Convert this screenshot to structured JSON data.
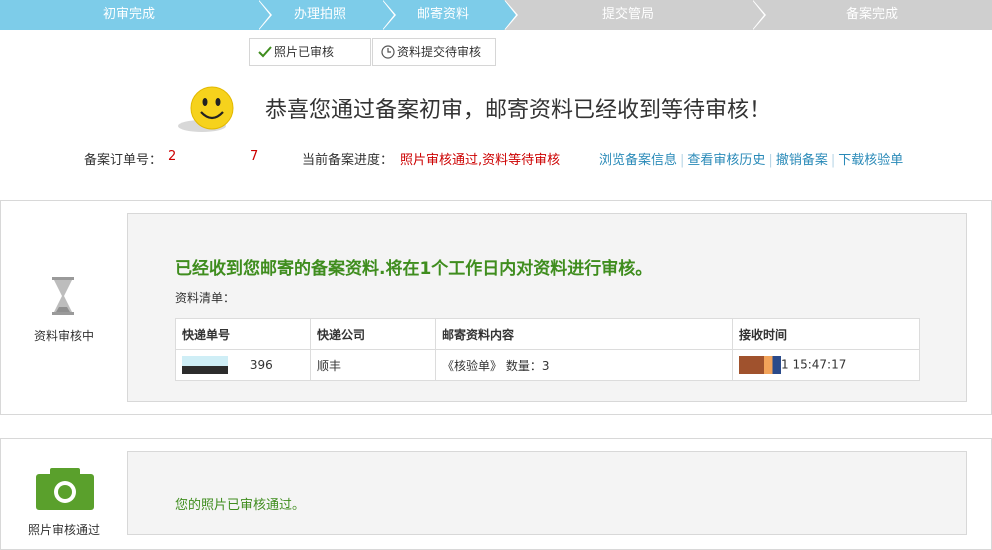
{
  "steps": [
    "初审完成",
    "办理拍照",
    "邮寄资料",
    "提交管局",
    "备案完成"
  ],
  "subtabs": [
    {
      "label": "照片已审核",
      "icon": "check-icon"
    },
    {
      "label": "资料提交待审核",
      "icon": "clock-icon"
    }
  ],
  "headline": "恭喜您通过备案初审，邮寄资料已经收到等待审核！",
  "order": {
    "label": "备案订单号：",
    "value_start": "2",
    "value_end": "7"
  },
  "progress": {
    "label": "当前备案进度：",
    "value": "照片审核通过,资料等待审核"
  },
  "links": [
    "浏览备案信息",
    "查看审核历史",
    "撤销备案",
    "下载核验单"
  ],
  "section1": {
    "side_label": "资料审核中",
    "icon": "hourglass-icon",
    "title": "已经收到您邮寄的备案资料.将在1个工作日内对资料进行审核。",
    "list_label": "资料清单：",
    "table": {
      "headers": [
        "快递单号",
        "快递公司",
        "邮寄资料内容",
        "接收时间"
      ],
      "rows": [
        {
          "tracking": "396",
          "company": "顺丰",
          "content": "《核验单》 数量：3",
          "received": "1 15:47:17"
        }
      ]
    }
  },
  "section2": {
    "side_label": "照片审核通过",
    "icon": "camera-icon",
    "message": "您的照片已审核通过。"
  },
  "colors": {
    "step_active": "#7dcce9",
    "step_inactive": "#cfcfcf",
    "green": "#3f8d1e",
    "red": "#cc0000",
    "link": "#2a8ab8"
  }
}
